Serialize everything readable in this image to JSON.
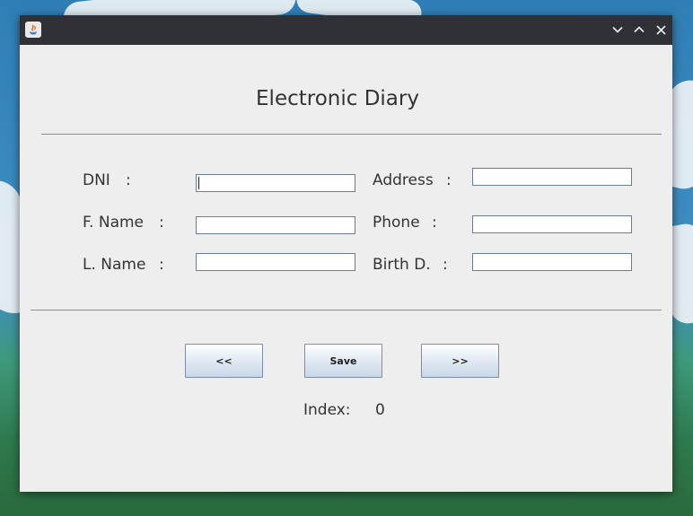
{
  "window": {
    "title": "",
    "controls": [
      "minimize",
      "maximize",
      "close"
    ]
  },
  "form": {
    "title": "Electronic Diary",
    "fields": {
      "dni": {
        "label": "DNI",
        "value": ""
      },
      "first_name": {
        "label": "F. Name",
        "value": ""
      },
      "last_name": {
        "label": "L. Name",
        "value": ""
      },
      "address": {
        "label": "Address",
        "value": ""
      },
      "phone": {
        "label": "Phone",
        "value": ""
      },
      "birth_date": {
        "label": "Birth D.",
        "value": ""
      }
    },
    "colon": ":"
  },
  "buttons": {
    "prev": "<<",
    "save": "Save",
    "next": ">>"
  },
  "index": {
    "label": "Index:",
    "value": "0"
  },
  "colors": {
    "titlebar": "#2f3136",
    "window_bg": "#eeeeee",
    "separator": "#7d8fb3"
  }
}
